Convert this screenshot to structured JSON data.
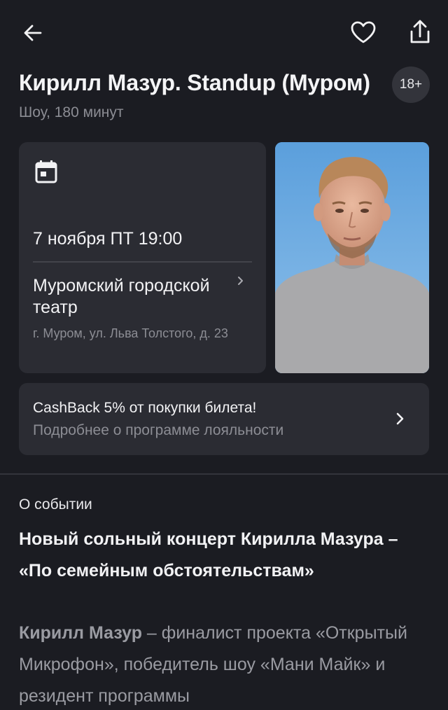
{
  "header": {
    "back_icon": "arrow-left-icon",
    "favorite_icon": "heart-icon",
    "share_icon": "share-icon"
  },
  "event": {
    "title": "Кирилл Мазур. Standup (Муром)",
    "age_rating": "18+",
    "subtitle": "Шоу, 180 минут"
  },
  "info": {
    "calendar_icon": "calendar-icon",
    "datetime": "7 ноября ПТ 19:00",
    "venue": "Муромский городской театр",
    "address": "г. Муром, ул. Льва Толстого, д. 23"
  },
  "cashback": {
    "title": "CashBack 5% от покупки билета!",
    "subtitle": "Подробнее о программе лояльности"
  },
  "about": {
    "label": "О событии",
    "headline": "Новый сольный концерт Кирилла Мазура – «По семейным обстоятельствам»",
    "name": "Кирилл Мазур",
    "text": " – финалист проекта «Открытый Микрофон», победитель шоу «Мани Майк» и резидент программы"
  },
  "colors": {
    "background": "#1b1c22",
    "card": "#2b2c33",
    "muted_text": "#8c8d94"
  }
}
